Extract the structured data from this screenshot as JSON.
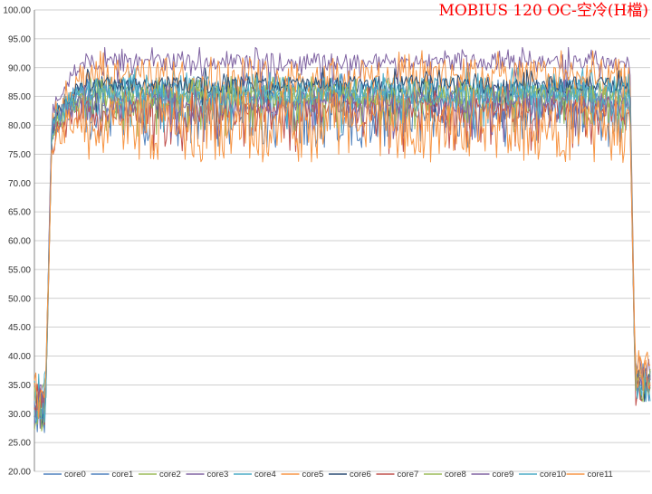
{
  "chart_data": {
    "type": "line",
    "title": "MOBIUS 120 OC-空冷(H檔)",
    "title_color": "#ff0000",
    "ylim": [
      20,
      100
    ],
    "y_ticks": [
      "20.00",
      "25.00",
      "30.00",
      "35.00",
      "40.00",
      "45.00",
      "50.00",
      "55.00",
      "60.00",
      "65.00",
      "70.00",
      "75.00",
      "80.00",
      "85.00",
      "90.00",
      "95.00",
      "100.00"
    ],
    "grid": true,
    "legend_position": "bottom",
    "n_points": 430,
    "series": [
      {
        "name": "core0",
        "color": "#4f81bd",
        "idle": 31,
        "ramp": 78,
        "load": 83.5,
        "spread": 2.5,
        "dips": 0.3,
        "end": 36
      },
      {
        "name": "core1",
        "color": "#4f81bd",
        "idle": 30,
        "ramp": 79,
        "load": 86,
        "spread": 2.0,
        "dips": 0.1,
        "end": 35
      },
      {
        "name": "core2",
        "color": "#9bbb59",
        "idle": 32,
        "ramp": 77,
        "load": 85,
        "spread": 2.0,
        "dips": 0.1,
        "end": 35
      },
      {
        "name": "core3",
        "color": "#8064a2",
        "idle": 31,
        "ramp": 80,
        "load": 91,
        "spread": 1.5,
        "dips": 0.05,
        "end": 37
      },
      {
        "name": "core4",
        "color": "#4bacc6",
        "idle": 33,
        "ramp": 79,
        "load": 86.5,
        "spread": 2.0,
        "dips": 0.1,
        "end": 36
      },
      {
        "name": "core5",
        "color": "#f79646",
        "idle": 34,
        "ramp": 78,
        "load": 88.5,
        "spread": 3.0,
        "dips": 0.1,
        "end": 38
      },
      {
        "name": "core6",
        "color": "#2c4d75",
        "idle": 31,
        "ramp": 78,
        "load": 87,
        "spread": 1.5,
        "dips": 0.05,
        "end": 35
      },
      {
        "name": "core7",
        "color": "#c0504d",
        "idle": 32,
        "ramp": 76,
        "load": 82.5,
        "spread": 2.5,
        "dips": 0.1,
        "end": 34
      },
      {
        "name": "core8",
        "color": "#9bbb59",
        "idle": 31,
        "ramp": 77,
        "load": 85,
        "spread": 2.0,
        "dips": 0.1,
        "end": 35
      },
      {
        "name": "core9",
        "color": "#8064a2",
        "idle": 32,
        "ramp": 79,
        "load": 84,
        "spread": 2.0,
        "dips": 0.1,
        "end": 36
      },
      {
        "name": "core10",
        "color": "#4bacc6",
        "idle": 31,
        "ramp": 78,
        "load": 85.5,
        "spread": 2.0,
        "dips": 0.1,
        "end": 35
      },
      {
        "name": "core11",
        "color": "#f79646",
        "idle": 33,
        "ramp": 77,
        "load": 82,
        "spread": 3.5,
        "dips": 0.35,
        "end": 37
      }
    ]
  }
}
